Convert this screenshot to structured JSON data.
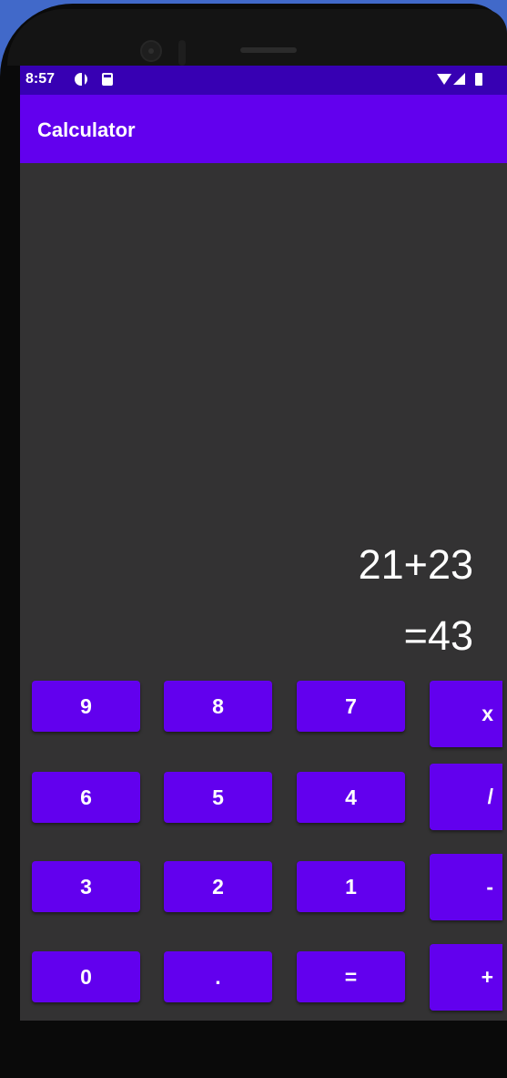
{
  "status_bar": {
    "time": "8:57",
    "icons": [
      "data-saver-icon",
      "sd-card-icon",
      "wifi-icon",
      "signal-icon",
      "battery-icon"
    ]
  },
  "app_bar": {
    "title": "Calculator"
  },
  "display": {
    "expression": "21+23",
    "result": "=43"
  },
  "keypad": {
    "digits": [
      [
        "9",
        "8",
        "7"
      ],
      [
        "6",
        "5",
        "4"
      ],
      [
        "3",
        "2",
        "1"
      ],
      [
        "0",
        ".",
        "="
      ]
    ],
    "operators": [
      "x",
      "/",
      "-",
      "+"
    ]
  },
  "nav_bar": {
    "icons": [
      "back-icon",
      "home-icon",
      "recents-icon"
    ]
  },
  "colors": {
    "primary": "#6200ee",
    "primary_dark": "#3700b3",
    "background": "#333233",
    "text": "#ffffff"
  }
}
